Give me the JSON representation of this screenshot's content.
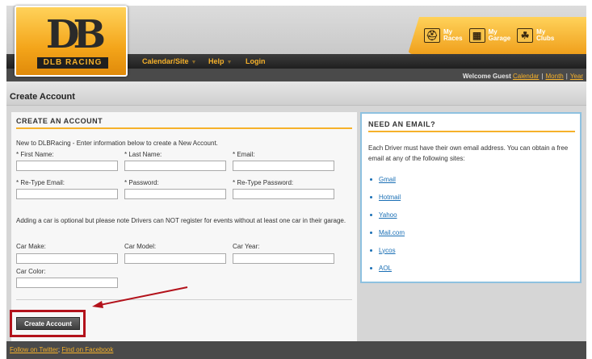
{
  "brand": {
    "logo_mark": "DB",
    "logo_text": "DLB RACING"
  },
  "nav": {
    "items": [
      {
        "label": "Calendar/Site",
        "has_caret": true
      },
      {
        "label": "Help",
        "has_caret": true
      },
      {
        "label": "Login",
        "has_caret": false
      }
    ]
  },
  "quick_links": [
    {
      "line1": "My",
      "line2": "Races",
      "icon": "helmet-icon",
      "glyph": "⛑"
    },
    {
      "line1": "My",
      "line2": "Garage",
      "icon": "garage-icon",
      "glyph": "▦"
    },
    {
      "line1": "My",
      "line2": "Clubs",
      "icon": "clubs-icon",
      "glyph": "☘"
    }
  ],
  "welcome": {
    "text": "Welcome Guest",
    "links": [
      "Calendar",
      "Month",
      "Year"
    ]
  },
  "page_title": "Create Account",
  "form": {
    "heading": "CREATE AN ACCOUNT",
    "intro": "New to DLBRacing - Enter information below to create a New Account.",
    "fields": {
      "first_name": {
        "label": "* First Name:",
        "value": ""
      },
      "last_name": {
        "label": "* Last Name:",
        "value": ""
      },
      "email": {
        "label": "* Email:",
        "value": ""
      },
      "retype_email": {
        "label": "* Re-Type Email:",
        "value": ""
      },
      "password": {
        "label": "* Password:",
        "value": ""
      },
      "retype_password": {
        "label": "* Re-Type Password:",
        "value": ""
      },
      "car_make": {
        "label": "Car Make:",
        "value": ""
      },
      "car_model": {
        "label": "Car Model:",
        "value": ""
      },
      "car_year": {
        "label": "Car Year:",
        "value": ""
      },
      "car_color": {
        "label": "Car Color:",
        "value": ""
      }
    },
    "car_note": "Adding a car is optional but please note Drivers can NOT register for events without at least one car in their garage.",
    "submit_label": "Create Account"
  },
  "email_panel": {
    "heading": "NEED AN EMAIL?",
    "text": "Each Driver must have their own email address. You can obtain a free email at any of the following sites:",
    "providers": [
      "Gmail",
      "Hotmail",
      "Yahoo",
      "Mail.com",
      "Lycos",
      "AOL"
    ]
  },
  "footer": {
    "links": [
      "Follow on Twitter",
      "Find on Facebook"
    ]
  },
  "colors": {
    "accent": "#f6b12a",
    "highlight": "#b3121b",
    "link": "#1a6fb5",
    "panel_border": "#8ec1e0"
  }
}
